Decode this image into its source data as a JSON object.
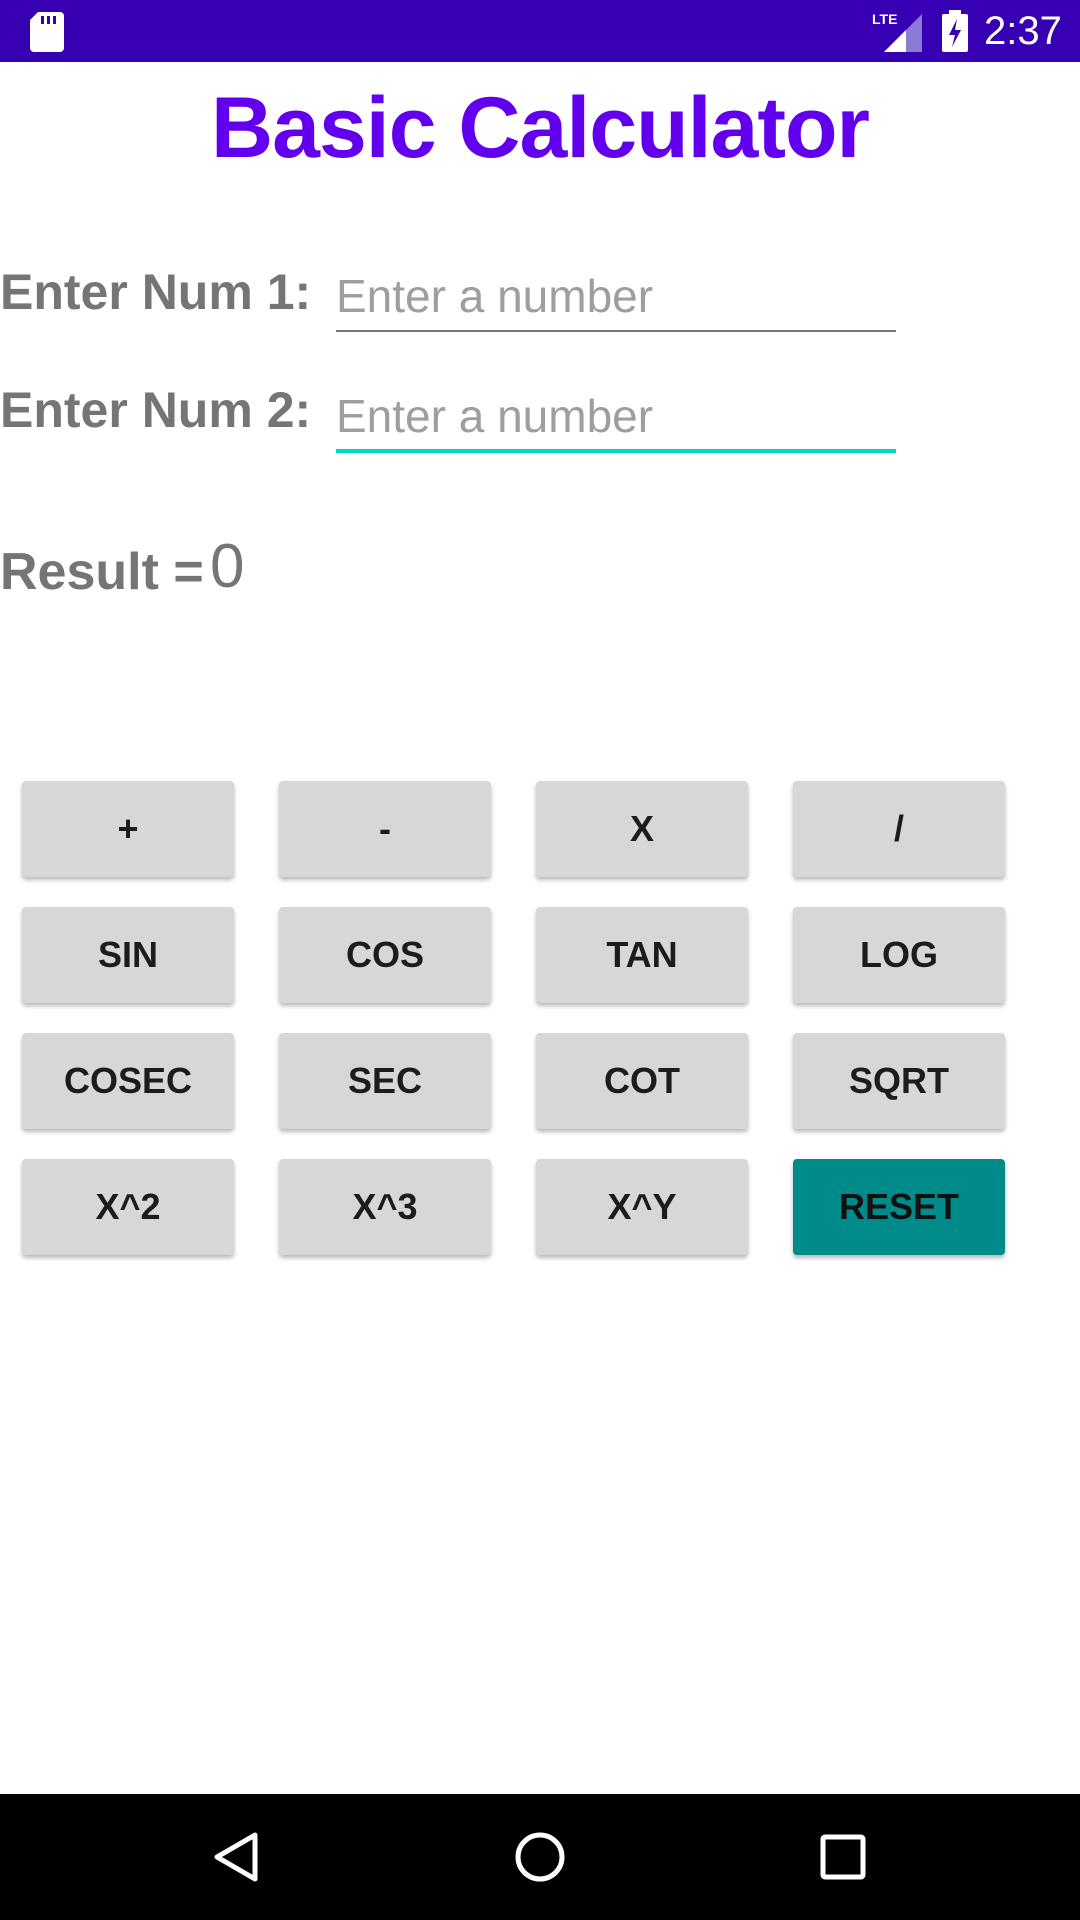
{
  "status_bar": {
    "time": "2:37",
    "network": "LTE",
    "icons": [
      "sd-card-icon",
      "lte-signal-icon",
      "battery-charging-icon"
    ],
    "background_color": "#3700B3"
  },
  "app": {
    "title": "Basic Calculator",
    "title_color": "#6200EE"
  },
  "inputs": {
    "num1": {
      "label": "Enter Num 1:",
      "placeholder": "Enter a number",
      "value": ""
    },
    "num2": {
      "label": "Enter Num 2:",
      "placeholder": "Enter a number",
      "value": "",
      "focused": true
    }
  },
  "result": {
    "label": "Result =",
    "value": "0"
  },
  "buttons": [
    [
      "+",
      "-",
      "X",
      "/"
    ],
    [
      "SIN",
      "COS",
      "TAN",
      "LOG"
    ],
    [
      "COSEC",
      "SEC",
      "COT",
      "SQRT"
    ],
    [
      "X^2",
      "X^3",
      "X^Y",
      "RESET"
    ]
  ],
  "colors": {
    "button": "#D6D7D7",
    "reset_button": "#008B8B",
    "focus_underline": "#03DAC5"
  },
  "nav_bar": {
    "icons": [
      "back-icon",
      "home-icon",
      "recents-icon"
    ]
  }
}
